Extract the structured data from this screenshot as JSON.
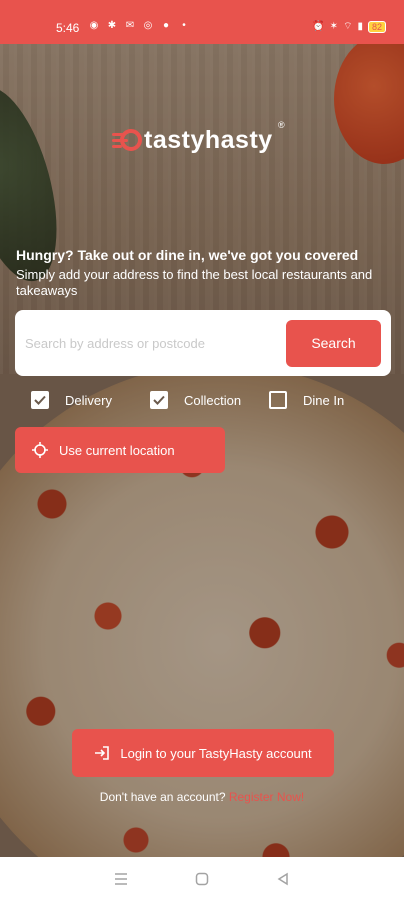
{
  "status_bar": {
    "time": "5:46",
    "battery": "82"
  },
  "brand": {
    "logo_text": "tastyhasty",
    "registered_mark": "®",
    "accent_color": "#e8534d"
  },
  "hero": {
    "headline": "Hungry? Take out or dine in, we've got you covered",
    "subline": "Simply add your address to find the best local restaurants and takeaways"
  },
  "search": {
    "placeholder": "Search by address or postcode",
    "value": "",
    "button_label": "Search"
  },
  "options": [
    {
      "label": "Delivery",
      "checked": true
    },
    {
      "label": "Collection",
      "checked": true
    },
    {
      "label": "Dine In",
      "checked": false
    }
  ],
  "location_button": {
    "label": "Use current location",
    "icon": "crosshair-icon"
  },
  "login_button": {
    "label": "Login to your TastyHasty account",
    "icon": "login-icon"
  },
  "register": {
    "prompt": "Don't have an account?",
    "link": "Register Now!"
  },
  "nav_bar": {
    "icons": [
      "menu-icon",
      "home-icon",
      "back-icon"
    ]
  }
}
